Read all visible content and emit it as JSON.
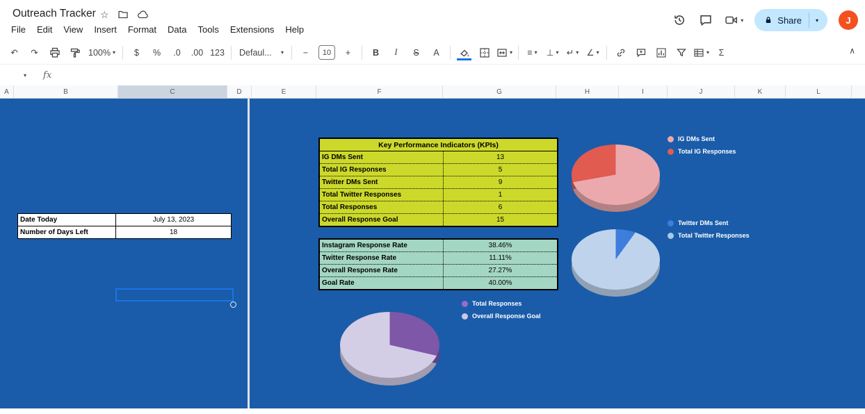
{
  "window": {
    "title": "Outreach Tracker"
  },
  "menubar": {
    "items": [
      "File",
      "Edit",
      "View",
      "Insert",
      "Format",
      "Data",
      "Tools",
      "Extensions",
      "Help"
    ]
  },
  "topbar_right": {
    "share_label": "Share",
    "avatar_letter": "J",
    "share_bg": "#c2e7ff",
    "avatar_color": "#f4511e"
  },
  "toolbar": {
    "zoom": "100%",
    "currency": "$",
    "percent": "%",
    "decimal_decrease": ".0",
    "decimal_increase": ".00",
    "more_formats": "123",
    "font_name": "Defaul...",
    "font_size": "10",
    "bold": "B",
    "italic": "I",
    "strikethrough": "S",
    "text_color": "A",
    "sum": "Σ"
  },
  "icons": {
    "undo": "↶",
    "redo": "↷",
    "dropdown": "▾",
    "minus": "−",
    "plus": "+",
    "star": "☆",
    "horizontal_align": "≡",
    "vertical_align": "⊥",
    "text_wrap": "↵",
    "text_rotation": "∠",
    "collapse": "∧"
  },
  "formula_bar": {
    "fx_label": "fx",
    "value": ""
  },
  "sheet": {
    "columns": [
      "A",
      "B",
      "C",
      "D",
      "E",
      "F",
      "G",
      "H",
      "I",
      "J",
      "K",
      "L"
    ],
    "selected_column": "C",
    "background_color": "#1a5ca9"
  },
  "info_table": {
    "rows": [
      {
        "label": "Date Today",
        "value": "July 13, 2023"
      },
      {
        "label": "Number of Days Left",
        "value": "18"
      }
    ]
  },
  "kpi_table": {
    "title": "Key Performance Indicators (KPIs)",
    "background_color": "#ccd92b",
    "rows": [
      {
        "label": "IG DMs Sent",
        "value": "13"
      },
      {
        "label": "Total IG Responses",
        "value": "5"
      },
      {
        "label": "Twitter DMs Sent",
        "value": "9"
      },
      {
        "label": "Total Twitter Responses",
        "value": "1"
      },
      {
        "label": "Total Responses",
        "value": "6"
      },
      {
        "label": "Overall Response Goal",
        "value": "15"
      }
    ]
  },
  "rate_table": {
    "background_color": "#a4d7c3",
    "rows": [
      {
        "label": "Instagram Response Rate",
        "value": "38.46%"
      },
      {
        "label": "Twitter Response Rate",
        "value": "11.11%"
      },
      {
        "label": "Overall Response Rate",
        "value": "27.27%"
      },
      {
        "label": "Goal Rate",
        "value": "40.00%"
      }
    ]
  },
  "chart_data": [
    {
      "type": "pie",
      "style": "3d",
      "categories": [
        "IG DMs Sent",
        "Total IG Responses"
      ],
      "values": [
        13,
        5
      ],
      "colors": [
        "#eba9ad",
        "#e15b50"
      ],
      "legend_position": "right"
    },
    {
      "type": "pie",
      "style": "3d",
      "categories": [
        "Twitter DMs Sent",
        "Total Twitter Responses"
      ],
      "values": [
        9,
        1
      ],
      "colors": [
        "#3d7edc",
        "#a9c7e8"
      ],
      "legend_position": "right"
    },
    {
      "type": "pie",
      "style": "3d",
      "categories": [
        "Total Responses",
        "Overall Response Goal"
      ],
      "values": [
        6,
        15
      ],
      "colors": [
        "#9a6cc6",
        "#cfc7e2"
      ],
      "legend_position": "top"
    }
  ]
}
